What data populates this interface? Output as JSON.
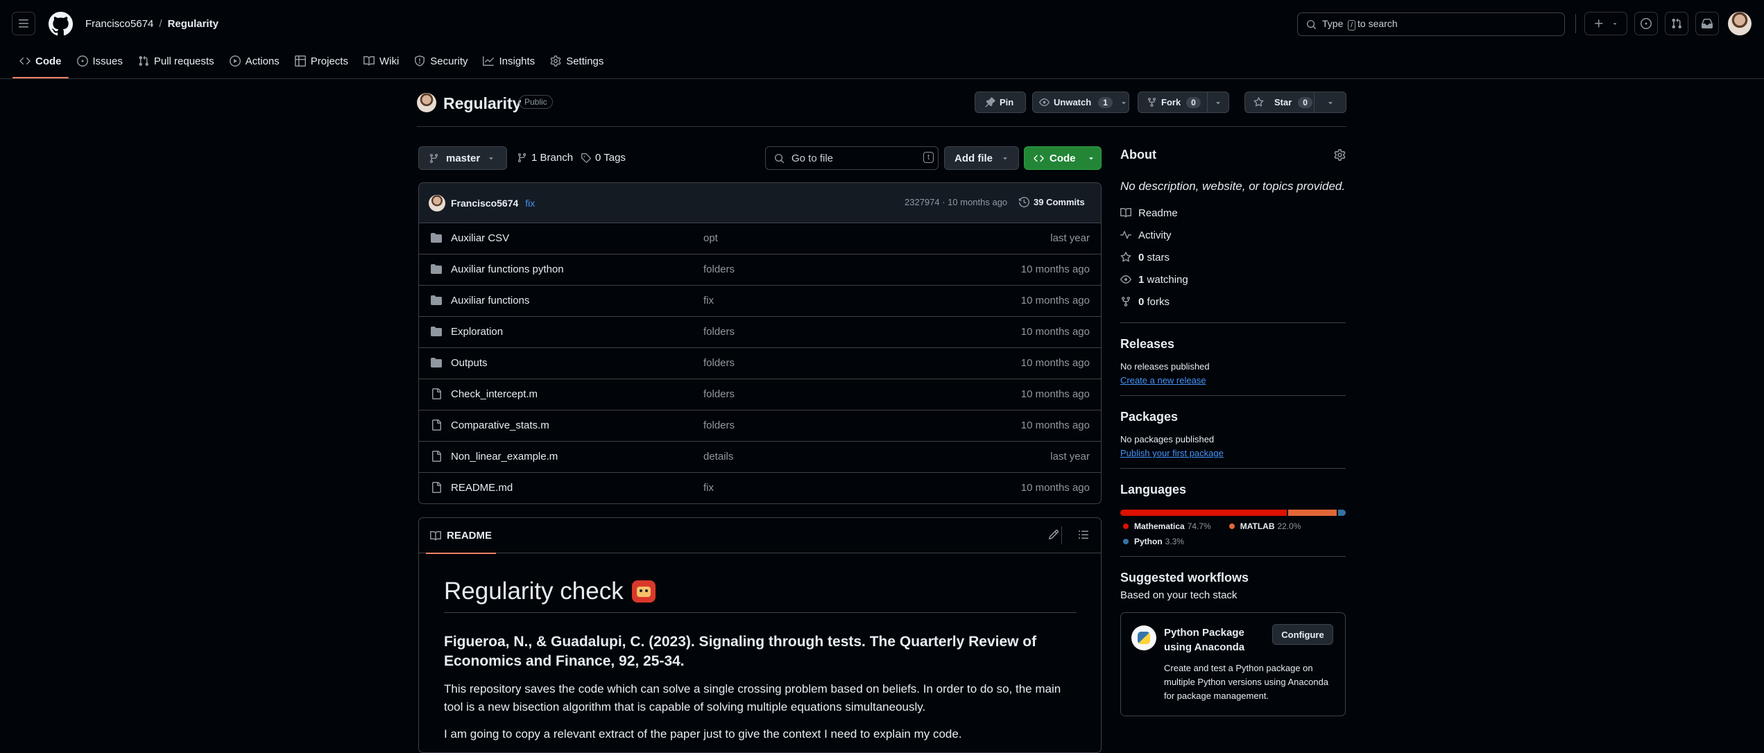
{
  "header": {
    "owner": "Francisco5674",
    "separator": "/",
    "repo": "Regularity",
    "search_prefix": "Type",
    "search_key": "/",
    "search_suffix": "to search"
  },
  "tabs": [
    {
      "label": "Code",
      "icon": "code-icon"
    },
    {
      "label": "Issues",
      "icon": "issue-opened-icon"
    },
    {
      "label": "Pull requests",
      "icon": "git-pull-request-icon"
    },
    {
      "label": "Actions",
      "icon": "play-icon"
    },
    {
      "label": "Projects",
      "icon": "table-icon"
    },
    {
      "label": "Wiki",
      "icon": "book-icon"
    },
    {
      "label": "Security",
      "icon": "shield-icon"
    },
    {
      "label": "Insights",
      "icon": "graph-icon"
    },
    {
      "label": "Settings",
      "icon": "gear-icon"
    }
  ],
  "repo_header": {
    "name": "Regularity",
    "visibility": "Public",
    "pin": "Pin",
    "unwatch": "Unwatch",
    "watch_count": "1",
    "fork": "Fork",
    "fork_count": "0",
    "star": "Star",
    "star_count": "0"
  },
  "branchbar": {
    "branch": "master",
    "branches": "1 Branch",
    "tags": "0 Tags",
    "goto_placeholder": "Go to file",
    "goto_key": "t",
    "add_file": "Add file",
    "code": "Code"
  },
  "commit": {
    "author": "Francisco5674",
    "message": "fix",
    "hash_time": "2327974 · 10 months ago",
    "commits": "39 Commits"
  },
  "files": [
    {
      "type": "folder",
      "name": "Auxiliar CSV",
      "message": "opt",
      "date": "last year"
    },
    {
      "type": "folder",
      "name": "Auxiliar functions python",
      "message": "folders",
      "date": "10 months ago"
    },
    {
      "type": "folder",
      "name": "Auxiliar functions",
      "message": "fix",
      "date": "10 months ago"
    },
    {
      "type": "folder",
      "name": "Exploration",
      "message": "folders",
      "date": "10 months ago"
    },
    {
      "type": "folder",
      "name": "Outputs",
      "message": "folders",
      "date": "10 months ago"
    },
    {
      "type": "file",
      "name": "Check_intercept.m",
      "message": "folders",
      "date": "10 months ago"
    },
    {
      "type": "file",
      "name": "Comparative_stats.m",
      "message": "folders",
      "date": "10 months ago"
    },
    {
      "type": "file",
      "name": "Non_linear_example.m",
      "message": "details",
      "date": "last year"
    },
    {
      "type": "file",
      "name": "README.md",
      "message": "fix",
      "date": "10 months ago"
    }
  ],
  "readme": {
    "tab": "README",
    "title": "Regularity check",
    "citation": "Figueroa, N., & Guadalupi, C. (2023). Signaling through tests. The Quarterly Review of Economics and Finance, 92, 25-34.",
    "para1": "This repository saves the code which can solve a single crossing problem based on beliefs. In order to do so, the main tool is a new bisection algorithm that is capable of solving multiple equations simultaneously.",
    "para2": "I am going to copy a relevant extract of the paper just to give the context I need to explain my code."
  },
  "about": {
    "heading": "About",
    "description": "No description, website, or topics provided.",
    "readme": "Readme",
    "activity": "Activity",
    "stars_count": "0",
    "stars_label": "stars",
    "watching_count": "1",
    "watching_label": "watching",
    "forks_count": "0",
    "forks_label": "forks"
  },
  "releases": {
    "heading": "Releases",
    "empty": "No releases published",
    "link": "Create a new release"
  },
  "packages": {
    "heading": "Packages",
    "empty": "No packages published",
    "link": "Publish your first package"
  },
  "languages": {
    "heading": "Languages",
    "items": [
      {
        "name": "Mathematica",
        "percent": "74.7%",
        "value": 74.7,
        "color": "#dd1100"
      },
      {
        "name": "MATLAB",
        "percent": "22.0%",
        "value": 22.0,
        "color": "#e16737"
      },
      {
        "name": "Python",
        "percent": "3.3%",
        "value": 3.3,
        "color": "#3572a5"
      }
    ]
  },
  "workflows": {
    "heading": "Suggested workflows",
    "subheading": "Based on your tech stack",
    "card_title": "Python Package using Anaconda",
    "card_desc": "Create and test a Python package on multiple Python versions using Anaconda for package management.",
    "configure": "Configure"
  },
  "colors": {
    "accent_green": "#238636",
    "tab_underline": "#f78166",
    "link": "#4493f8"
  }
}
